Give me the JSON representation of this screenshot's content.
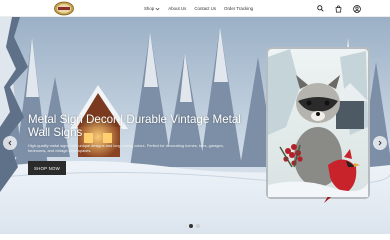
{
  "header": {
    "logo_icon": "vintage-sign-logo-icon",
    "nav": [
      {
        "label": "Shop",
        "has_dropdown": true
      },
      {
        "label": "About Us"
      },
      {
        "label": "Contact Us"
      },
      {
        "label": "Order Tracking"
      }
    ],
    "icons": [
      "search-icon",
      "cart-icon",
      "account-icon"
    ]
  },
  "hero": {
    "headline": "Metal Sign Decor | Durable Vintage Metal Wall Signs",
    "subtext": "High-quality metal signs with unique designs and long-lasting colors. Perfect for decorating homes, bars, garages, bedrooms, and vintage-style spaces.",
    "cta_label": "SHOP NOW",
    "slides_count": 2,
    "active_slide": 1
  },
  "colors": {
    "cta_bg": "#2b2b2b",
    "header_bg": "#ffffff",
    "text_light": "#ffffff"
  }
}
